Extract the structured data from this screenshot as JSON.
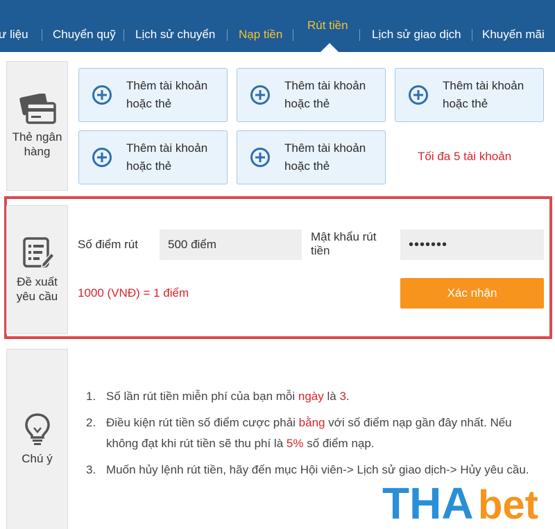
{
  "nav": {
    "items": [
      {
        "label": "ư liệu",
        "style": "white"
      },
      {
        "label": "Chuyển quỹ",
        "style": "white"
      },
      {
        "label": "Lịch sử chuyển",
        "style": "white"
      },
      {
        "label": "Nạp tiền",
        "style": "yellow"
      },
      {
        "label": "Rút tiền",
        "style": "active"
      },
      {
        "label": "Lịch sử giao dịch",
        "style": "white"
      },
      {
        "label": "Khuyến mãi",
        "style": "white"
      }
    ]
  },
  "bank": {
    "side_label": "Thẻ ngân hàng",
    "side_icon": "bank-card-icon",
    "add_card": {
      "line1": "Thêm tài khoản",
      "line2": "hoặc thẻ"
    },
    "limit_text": "Tối đa 5 tài khoản"
  },
  "request": {
    "side_label": "Đề xuất yêu cầu",
    "side_icon": "form-edit-icon",
    "points_label": "Số điểm rút",
    "points_value": "500 điểm",
    "password_label": "Mật khẩu rút tiền",
    "password_value": "•••••••",
    "rate_text": "1000 (VNĐ) = 1 điểm",
    "confirm_label": "Xác nhận"
  },
  "notes": {
    "side_label": "Chú ý",
    "side_icon": "lightbulb-icon",
    "n1": {
      "num": "1.",
      "a": "Số lần rút tiền miễn phí của bạn mỗi ",
      "b": "ngày",
      "c": " là ",
      "d": "3",
      "e": "."
    },
    "n2": {
      "num": "2.",
      "a": "Điều kiện rút tiền số điểm cược phải ",
      "b": "bằng",
      "c": " với số điểm nạp gần đây nhất. Nếu không đạt khi rút tiền sẽ thu phí là ",
      "d": "5%",
      "e": " số điểm nạp."
    },
    "n3": {
      "num": "3.",
      "a": "Muốn hủy lệnh rút tiền, hãy đến mục Hội viên-> Lịch sử giao dịch-> Hủy yêu cầu."
    }
  },
  "logo": {
    "text_a": "THA",
    "text_b": "bet"
  },
  "colors": {
    "nav_bg": "#1f5b94",
    "accent_orange": "#f7941d",
    "highlight_red": "#d8262b",
    "card_bg": "#e9f3fc",
    "logo_blue": "#2a8fd6"
  }
}
